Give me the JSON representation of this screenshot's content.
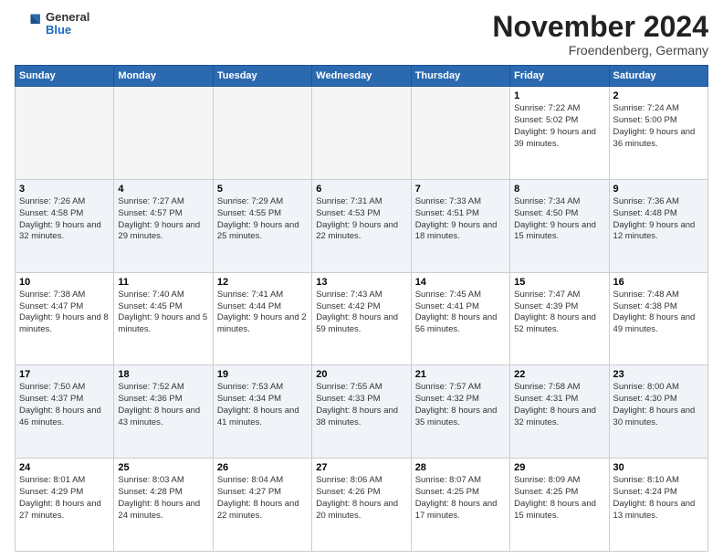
{
  "header": {
    "logo_general": "General",
    "logo_blue": "Blue",
    "month_title": "November 2024",
    "location": "Froendenberg, Germany"
  },
  "days_of_week": [
    "Sunday",
    "Monday",
    "Tuesday",
    "Wednesday",
    "Thursday",
    "Friday",
    "Saturday"
  ],
  "weeks": [
    [
      {
        "day": "",
        "info": ""
      },
      {
        "day": "",
        "info": ""
      },
      {
        "day": "",
        "info": ""
      },
      {
        "day": "",
        "info": ""
      },
      {
        "day": "",
        "info": ""
      },
      {
        "day": "1",
        "info": "Sunrise: 7:22 AM\nSunset: 5:02 PM\nDaylight: 9 hours and 39 minutes."
      },
      {
        "day": "2",
        "info": "Sunrise: 7:24 AM\nSunset: 5:00 PM\nDaylight: 9 hours and 36 minutes."
      }
    ],
    [
      {
        "day": "3",
        "info": "Sunrise: 7:26 AM\nSunset: 4:58 PM\nDaylight: 9 hours and 32 minutes."
      },
      {
        "day": "4",
        "info": "Sunrise: 7:27 AM\nSunset: 4:57 PM\nDaylight: 9 hours and 29 minutes."
      },
      {
        "day": "5",
        "info": "Sunrise: 7:29 AM\nSunset: 4:55 PM\nDaylight: 9 hours and 25 minutes."
      },
      {
        "day": "6",
        "info": "Sunrise: 7:31 AM\nSunset: 4:53 PM\nDaylight: 9 hours and 22 minutes."
      },
      {
        "day": "7",
        "info": "Sunrise: 7:33 AM\nSunset: 4:51 PM\nDaylight: 9 hours and 18 minutes."
      },
      {
        "day": "8",
        "info": "Sunrise: 7:34 AM\nSunset: 4:50 PM\nDaylight: 9 hours and 15 minutes."
      },
      {
        "day": "9",
        "info": "Sunrise: 7:36 AM\nSunset: 4:48 PM\nDaylight: 9 hours and 12 minutes."
      }
    ],
    [
      {
        "day": "10",
        "info": "Sunrise: 7:38 AM\nSunset: 4:47 PM\nDaylight: 9 hours and 8 minutes."
      },
      {
        "day": "11",
        "info": "Sunrise: 7:40 AM\nSunset: 4:45 PM\nDaylight: 9 hours and 5 minutes."
      },
      {
        "day": "12",
        "info": "Sunrise: 7:41 AM\nSunset: 4:44 PM\nDaylight: 9 hours and 2 minutes."
      },
      {
        "day": "13",
        "info": "Sunrise: 7:43 AM\nSunset: 4:42 PM\nDaylight: 8 hours and 59 minutes."
      },
      {
        "day": "14",
        "info": "Sunrise: 7:45 AM\nSunset: 4:41 PM\nDaylight: 8 hours and 56 minutes."
      },
      {
        "day": "15",
        "info": "Sunrise: 7:47 AM\nSunset: 4:39 PM\nDaylight: 8 hours and 52 minutes."
      },
      {
        "day": "16",
        "info": "Sunrise: 7:48 AM\nSunset: 4:38 PM\nDaylight: 8 hours and 49 minutes."
      }
    ],
    [
      {
        "day": "17",
        "info": "Sunrise: 7:50 AM\nSunset: 4:37 PM\nDaylight: 8 hours and 46 minutes."
      },
      {
        "day": "18",
        "info": "Sunrise: 7:52 AM\nSunset: 4:36 PM\nDaylight: 8 hours and 43 minutes."
      },
      {
        "day": "19",
        "info": "Sunrise: 7:53 AM\nSunset: 4:34 PM\nDaylight: 8 hours and 41 minutes."
      },
      {
        "day": "20",
        "info": "Sunrise: 7:55 AM\nSunset: 4:33 PM\nDaylight: 8 hours and 38 minutes."
      },
      {
        "day": "21",
        "info": "Sunrise: 7:57 AM\nSunset: 4:32 PM\nDaylight: 8 hours and 35 minutes."
      },
      {
        "day": "22",
        "info": "Sunrise: 7:58 AM\nSunset: 4:31 PM\nDaylight: 8 hours and 32 minutes."
      },
      {
        "day": "23",
        "info": "Sunrise: 8:00 AM\nSunset: 4:30 PM\nDaylight: 8 hours and 30 minutes."
      }
    ],
    [
      {
        "day": "24",
        "info": "Sunrise: 8:01 AM\nSunset: 4:29 PM\nDaylight: 8 hours and 27 minutes."
      },
      {
        "day": "25",
        "info": "Sunrise: 8:03 AM\nSunset: 4:28 PM\nDaylight: 8 hours and 24 minutes."
      },
      {
        "day": "26",
        "info": "Sunrise: 8:04 AM\nSunset: 4:27 PM\nDaylight: 8 hours and 22 minutes."
      },
      {
        "day": "27",
        "info": "Sunrise: 8:06 AM\nSunset: 4:26 PM\nDaylight: 8 hours and 20 minutes."
      },
      {
        "day": "28",
        "info": "Sunrise: 8:07 AM\nSunset: 4:25 PM\nDaylight: 8 hours and 17 minutes."
      },
      {
        "day": "29",
        "info": "Sunrise: 8:09 AM\nSunset: 4:25 PM\nDaylight: 8 hours and 15 minutes."
      },
      {
        "day": "30",
        "info": "Sunrise: 8:10 AM\nSunset: 4:24 PM\nDaylight: 8 hours and 13 minutes."
      }
    ]
  ]
}
